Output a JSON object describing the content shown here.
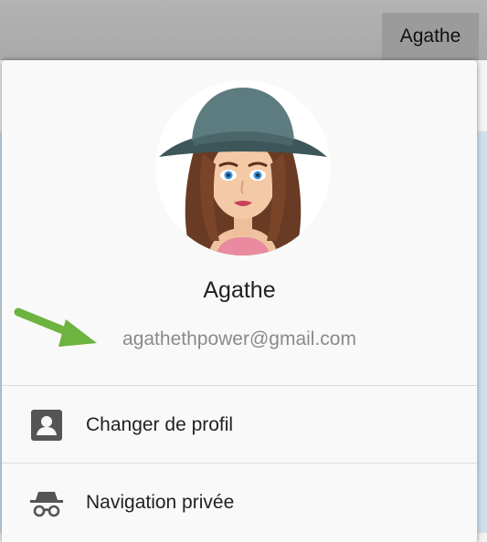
{
  "window": {
    "profile_button_label": "Agathe"
  },
  "profile": {
    "name": "Agathe",
    "email": "agathethpower@gmail.com"
  },
  "menu": {
    "items": [
      {
        "label": "Changer de profil",
        "icon": "person-badge-icon"
      },
      {
        "label": "Navigation privée",
        "icon": "incognito-icon"
      }
    ]
  },
  "colors": {
    "accent_arrow": "#6db33f"
  }
}
